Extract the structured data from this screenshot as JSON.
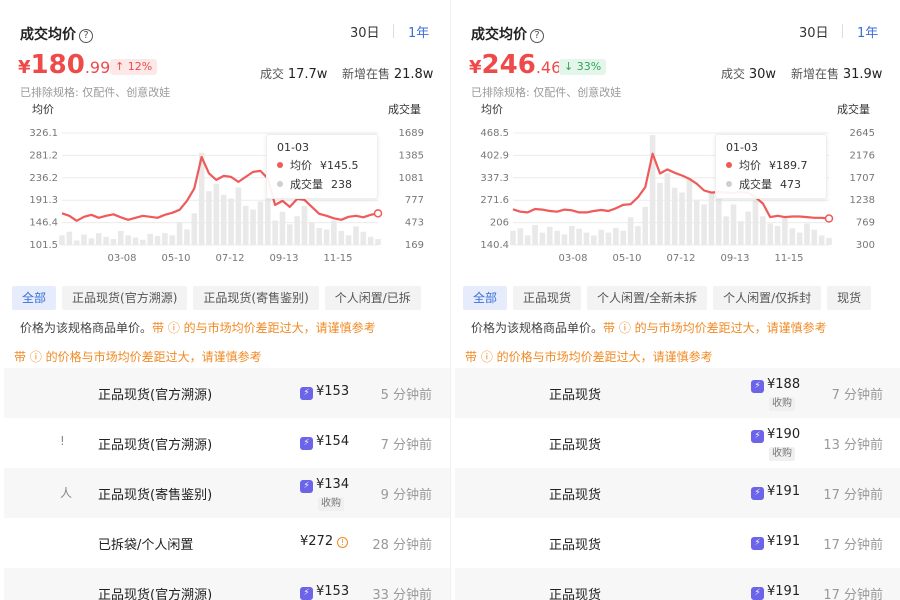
{
  "left": {
    "title": "成交均价",
    "range_tabs": [
      "30日",
      "1年"
    ],
    "price": {
      "currency": "¥",
      "int": "180",
      "dec": ".99"
    },
    "change": {
      "arrow": "↑",
      "text": "12%",
      "direction": "up"
    },
    "stats": {
      "deals_label": "成交",
      "deals_value": "17.7w",
      "listed_label": "新增在售",
      "listed_value": "21.8w"
    },
    "excluded_note": "已排除规格: 仅配件、创意改娃",
    "y_left_title": "均价",
    "y_right_title": "成交量",
    "tooltip": {
      "date": "01-03",
      "avg_label": "均价",
      "avg_value": "¥145.5",
      "vol_label": "成交量",
      "vol_value": "238"
    },
    "filters": [
      "全部",
      "正品现货(官方溯源)",
      "正品现货(寄售鉴别)",
      "个人闲置/已拆"
    ],
    "note_text": "价格为该规格商品单价。",
    "note_warn": "带 ⓘ 的与市场均价差距过大，请谨慎参考",
    "warn_line": "带 ⓘ 的价格与市场均价差距过大，请谨慎参考",
    "transactions": [
      {
        "glyph": "",
        "condition": "正品现货(官方溯源)",
        "price": "¥153",
        "bolt": true,
        "tag": "",
        "warn": false,
        "time": "5 分钟前"
      },
      {
        "glyph": "!",
        "condition": "正品现货(官方溯源)",
        "price": "¥154",
        "bolt": true,
        "tag": "",
        "warn": false,
        "time": "7 分钟前"
      },
      {
        "glyph": "人",
        "condition": "正品现货(寄售鉴别)",
        "price": "¥134",
        "bolt": true,
        "tag": "收购",
        "warn": false,
        "time": "9 分钟前"
      },
      {
        "glyph": "",
        "condition": "已拆袋/个人闲置",
        "price": "¥272",
        "bolt": false,
        "tag": "",
        "warn": true,
        "time": "28 分钟前"
      },
      {
        "glyph": "",
        "condition": "正品现货(官方溯源)",
        "price": "¥153",
        "bolt": true,
        "tag": "",
        "warn": false,
        "time": "33 分钟前"
      }
    ]
  },
  "right": {
    "title": "成交均价",
    "range_tabs": [
      "30日",
      "1年"
    ],
    "price": {
      "currency": "¥",
      "int": "246",
      "dec": ".46"
    },
    "change": {
      "arrow": "↓",
      "text": "33%",
      "direction": "down"
    },
    "stats": {
      "deals_label": "成交",
      "deals_value": "30w",
      "listed_label": "新增在售",
      "listed_value": "31.9w"
    },
    "excluded_note": "已排除规格: 仅配件、创意改娃",
    "y_left_title": "均价",
    "y_right_title": "成交量",
    "tooltip": {
      "date": "01-03",
      "avg_label": "均价",
      "avg_value": "¥189.7",
      "vol_label": "成交量",
      "vol_value": "473"
    },
    "filters": [
      "全部",
      "正品现货",
      "个人闲置/全新未拆",
      "个人闲置/仅拆封",
      "现货"
    ],
    "note_text": "价格为该规格商品单价。",
    "note_warn": "带 ⓘ 的与市场均价差距过大，请谨慎参考",
    "warn_line": "带 ⓘ 的价格与市场均价差距过大，请谨慎参考",
    "transactions": [
      {
        "glyph": "",
        "condition": "正品现货",
        "price": "¥188",
        "bolt": true,
        "tag": "收购",
        "warn": false,
        "time": "7 分钟前"
      },
      {
        "glyph": "",
        "condition": "正品现货",
        "price": "¥190",
        "bolt": true,
        "tag": "收购",
        "warn": false,
        "time": "13 分钟前"
      },
      {
        "glyph": "",
        "condition": "正品现货",
        "price": "¥191",
        "bolt": true,
        "tag": "",
        "warn": false,
        "time": "17 分钟前"
      },
      {
        "glyph": "",
        "condition": "正品现货",
        "price": "¥191",
        "bolt": true,
        "tag": "",
        "warn": false,
        "time": "17 分钟前"
      },
      {
        "glyph": "",
        "condition": "正品现货",
        "price": "¥191",
        "bolt": true,
        "tag": "",
        "warn": false,
        "time": "17 分钟前"
      }
    ]
  },
  "colors": {
    "accent": "#3b6fd6",
    "price_red": "#ef4a4a",
    "line": "#ef5a5a",
    "warn": "#f08a24",
    "bolt": "#6b63e8"
  },
  "chart_data": [
    {
      "type": "line",
      "x_ticks": [
        "03-08",
        "05-10",
        "07-12",
        "09-13",
        "11-15"
      ],
      "y_left_ticks": [
        "326.1",
        "281.2",
        "236.2",
        "191.3",
        "146.4",
        "101.5"
      ],
      "y_right_ticks": [
        "1689",
        "1385",
        "1081",
        "777",
        "473",
        "169"
      ],
      "ylim_left": [
        101.5,
        326.1
      ],
      "ylim_right": [
        169,
        1689
      ],
      "series": [
        {
          "values": [
            165,
            160,
            150,
            158,
            162,
            156,
            160,
            163,
            157,
            152,
            156,
            160,
            158,
            156,
            162,
            166,
            172,
            190,
            215,
            278,
            245,
            232,
            240,
            238,
            228,
            238,
            248,
            250,
            235,
            182,
            190,
            178,
            194,
            192,
            178,
            164,
            160,
            155,
            152,
            158,
            160,
            157,
            162,
            165
          ]
        },
        {
          "values": [
            300,
            350,
            230,
            310,
            260,
            330,
            280,
            250,
            360,
            300,
            270,
            240,
            320,
            290,
            330,
            300,
            480,
            380,
            600,
            1420,
            900,
            1000,
            850,
            800,
            950,
            700,
            650,
            760,
            800,
            500,
            620,
            450,
            560,
            700,
            480,
            400,
            380,
            500,
            360,
            300,
            420,
            350,
            280,
            250
          ]
        }
      ]
    },
    {
      "type": "line",
      "x_ticks": [
        "03-08",
        "05-10",
        "07-12",
        "09-13",
        "11-15"
      ],
      "y_left_ticks": [
        "468.5",
        "402.9",
        "337.3",
        "271.6",
        "206",
        "140.4"
      ],
      "y_right_ticks": [
        "2645",
        "2176",
        "1707",
        "1238",
        "769",
        "300"
      ],
      "ylim_left": [
        140.4,
        468.5
      ],
      "ylim_right": [
        300,
        2645
      ],
      "series": [
        {
          "values": [
            245,
            238,
            236,
            246,
            244,
            240,
            238,
            244,
            242,
            236,
            236,
            240,
            243,
            240,
            248,
            258,
            260,
            280,
            310,
            408,
            350,
            362,
            352,
            344,
            334,
            320,
            300,
            294,
            296,
            294,
            292,
            296,
            294,
            280,
            262,
            222,
            226,
            222,
            224,
            224,
            222,
            220,
            220,
            218
          ]
        },
        {
          "values": [
            600,
            650,
            500,
            720,
            560,
            680,
            600,
            520,
            700,
            640,
            560,
            500,
            620,
            560,
            660,
            600,
            880,
            700,
            1100,
            2600,
            1600,
            1800,
            1500,
            1400,
            1700,
            1250,
            1150,
            1400,
            1450,
            900,
            1150,
            800,
            1000,
            1250,
            900,
            750,
            700,
            900,
            650,
            560,
            750,
            620,
            500,
            450
          ]
        }
      ]
    }
  ]
}
